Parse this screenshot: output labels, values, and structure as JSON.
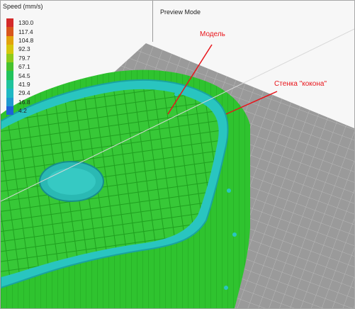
{
  "legend": {
    "title": "Speed (mm/s)",
    "items": [
      {
        "label": "130.0",
        "color": "#d42a2a"
      },
      {
        "label": "117.4",
        "color": "#d8561c"
      },
      {
        "label": "104.8",
        "color": "#e2a30c"
      },
      {
        "label": "92.3",
        "color": "#d6c70d"
      },
      {
        "label": "79.7",
        "color": "#8fcb1b"
      },
      {
        "label": "67.1",
        "color": "#46c22e"
      },
      {
        "label": "54.5",
        "color": "#21c35b"
      },
      {
        "label": "41.9",
        "color": "#1ec39c"
      },
      {
        "label": "29.4",
        "color": "#1eb8c3"
      },
      {
        "label": "16.8",
        "color": "#1e9ad0"
      },
      {
        "label": "4.2",
        "color": "#1e62d8"
      }
    ]
  },
  "view": {
    "mode_label": "Preview Mode"
  },
  "annotations": {
    "model_label": "Модель",
    "wall_label": "Стенка \"кокона\""
  },
  "colors": {
    "model_green": "#2ec42e",
    "model_green_dark": "#1f9a1f",
    "wall_cyan": "#27c6c0",
    "bed_grey": "#8e8e8e",
    "annotation_red": "#e8141a"
  }
}
